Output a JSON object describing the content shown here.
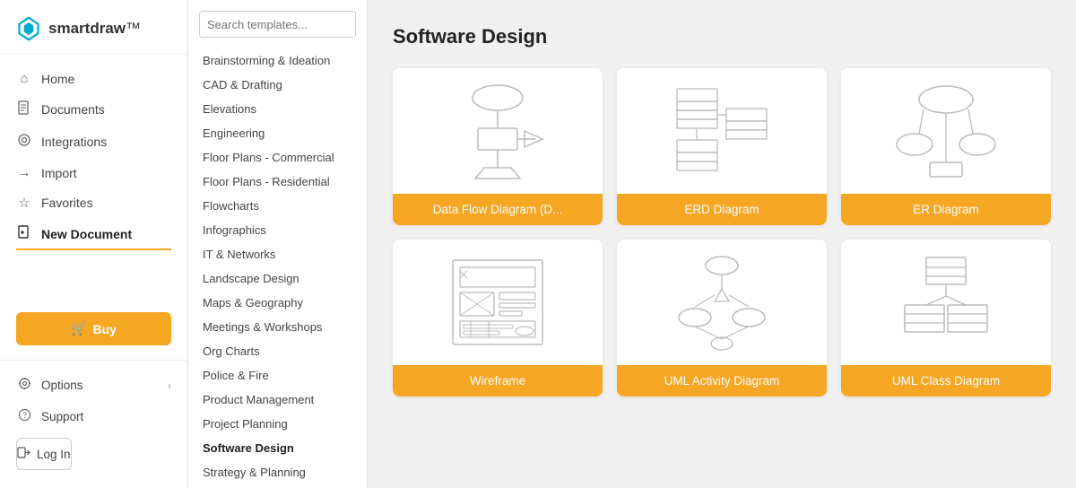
{
  "app": {
    "name_start": "smart",
    "name_end": "draw",
    "logo_symbol": "◈"
  },
  "sidebar": {
    "nav_items": [
      {
        "label": "Home",
        "icon": "⌂",
        "id": "home"
      },
      {
        "label": "Documents",
        "icon": "◻",
        "id": "documents"
      },
      {
        "label": "Integrations",
        "icon": "◉",
        "id": "integrations"
      },
      {
        "label": "Import",
        "icon": "→",
        "id": "import"
      },
      {
        "label": "Favorites",
        "icon": "☆",
        "id": "favorites"
      },
      {
        "label": "New Document",
        "icon": "◻",
        "id": "new-document",
        "active": true
      }
    ],
    "buy_label": "🛒 Buy",
    "bottom_items": [
      {
        "label": "Options",
        "icon": "⚙",
        "has_arrow": true
      },
      {
        "label": "Support",
        "icon": "?"
      }
    ],
    "login_label": "↪ Log In"
  },
  "category_panel": {
    "search_placeholder": "Search templates...",
    "categories": [
      {
        "label": "Brainstorming & Ideation"
      },
      {
        "label": "CAD & Drafting"
      },
      {
        "label": "Elevations"
      },
      {
        "label": "Engineering"
      },
      {
        "label": "Floor Plans - Commercial"
      },
      {
        "label": "Floor Plans - Residential"
      },
      {
        "label": "Flowcharts"
      },
      {
        "label": "Infographics"
      },
      {
        "label": "IT & Networks"
      },
      {
        "label": "Landscape Design"
      },
      {
        "label": "Maps & Geography"
      },
      {
        "label": "Meetings & Workshops"
      },
      {
        "label": "Org Charts"
      },
      {
        "label": "Police & Fire"
      },
      {
        "label": "Product Management"
      },
      {
        "label": "Project Planning"
      },
      {
        "label": "Software Design",
        "active": true
      },
      {
        "label": "Strategy & Planning"
      }
    ]
  },
  "main": {
    "title": "Software Design",
    "templates": [
      {
        "label": "Data Flow Diagram (D..."
      },
      {
        "label": "ERD Diagram"
      },
      {
        "label": "ER Diagram"
      },
      {
        "label": "Wireframe"
      },
      {
        "label": "UML Activity Diagram"
      },
      {
        "label": "UML Class Diagram"
      }
    ]
  }
}
